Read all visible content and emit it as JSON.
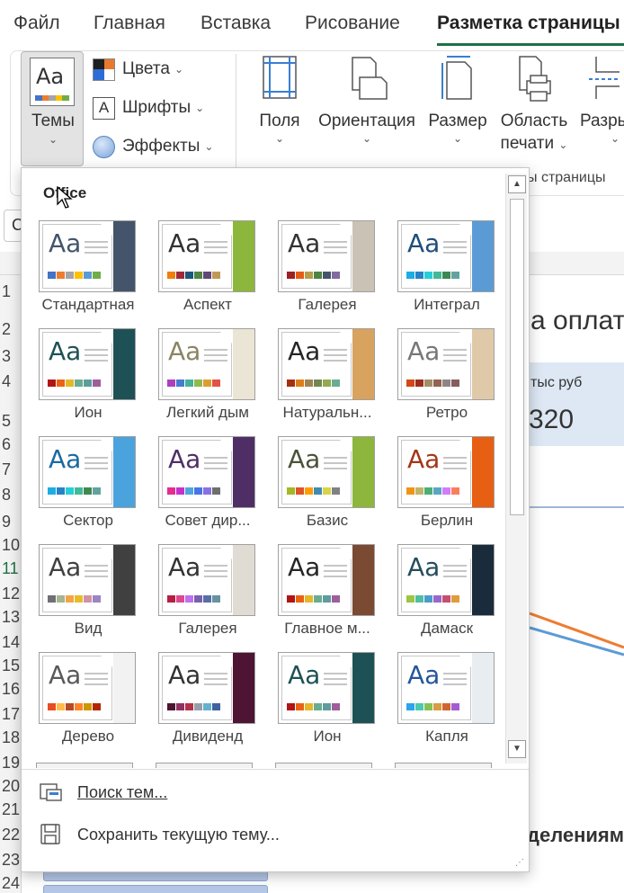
{
  "tabs": [
    "Файл",
    "Главная",
    "Вставка",
    "Рисование",
    "Разметка страницы"
  ],
  "ribbon": {
    "themes_label": "Темы",
    "colors_label": "Цвета",
    "fonts_label": "Шрифты",
    "effects_label": "Эффекты",
    "margins_label": "Поля",
    "orientation_label": "Ориентация",
    "size_label": "Размер",
    "print_area_line1": "Область",
    "print_area_line2": "печати",
    "breaks_label": "Разры",
    "group_label": "ы страницы",
    "icons": [
      "themes-icon",
      "colors-icon",
      "fonts-icon",
      "effects-icon",
      "margins-icon",
      "orientation-icon",
      "size-icon",
      "print-area-icon",
      "breaks-icon"
    ]
  },
  "sheet": {
    "namebox_text": "С",
    "rows": [
      "1",
      "2",
      "3",
      "4",
      "5",
      "6",
      "7",
      "8",
      "9",
      "10",
      "11",
      "12",
      "13",
      "14",
      "15",
      "16",
      "17",
      "18",
      "19",
      "20",
      "21",
      "22",
      "23",
      "24"
    ],
    "title_fragment": "а оплат",
    "unit_fragment": "тыс руб",
    "value_fragment": "320",
    "bottom_fragment": "делениям"
  },
  "dropdown": {
    "section_title": "Office",
    "themes": [
      {
        "name": "Стандартная",
        "font_color": "#44546a",
        "accent": "#44546a",
        "swatches": [
          "#4472c4",
          "#ed7d31",
          "#a5a5a5",
          "#ffc000",
          "#5b9bd5",
          "#70ad47"
        ]
      },
      {
        "name": "Аспект",
        "font_color": "#323232",
        "accent": "#8db63c",
        "swatches": [
          "#f07f09",
          "#9f2936",
          "#1b587c",
          "#4e8542",
          "#604878",
          "#c19859"
        ]
      },
      {
        "name": "Галерея",
        "font_color": "#333333",
        "accent": "#c9c2b5",
        "swatches": [
          "#9c2222",
          "#e55c18",
          "#b79c4a",
          "#4e8542",
          "#44546a",
          "#826b9e"
        ]
      },
      {
        "name": "Интеграл",
        "font_color": "#1f4e79",
        "accent": "#5b9bd5",
        "swatches": [
          "#1cade4",
          "#2683c6",
          "#27ced7",
          "#42ba97",
          "#3e8853",
          "#62a39f"
        ]
      },
      {
        "name": "Ион",
        "font_color": "#1e5155",
        "accent": "#1e5155",
        "swatches": [
          "#b01513",
          "#ea6312",
          "#e6b729",
          "#6aac90",
          "#5f9c9d",
          "#9e5e9b"
        ]
      },
      {
        "name": "Легкий дым",
        "font_color": "#8a8564",
        "accent": "#eae5d4",
        "swatches": [
          "#ac3ec1",
          "#477bd1",
          "#46b298",
          "#90ba4c",
          "#dd9d31",
          "#e25345"
        ]
      },
      {
        "name": "Натуральн...",
        "font_color": "#262626",
        "accent": "#d7a35f",
        "swatches": [
          "#a53010",
          "#de7e18",
          "#9f8351",
          "#728653",
          "#92aa4c",
          "#6aac91"
        ]
      },
      {
        "name": "Ретро",
        "font_color": "#777777",
        "accent": "#e0c9a8",
        "swatches": [
          "#d34817",
          "#9b2d1f",
          "#a28e6a",
          "#956251",
          "#918485",
          "#855d5d"
        ]
      },
      {
        "name": "Сектор",
        "font_color": "#1a6aa1",
        "accent": "#4ba3dd",
        "swatches": [
          "#1cade4",
          "#2683c6",
          "#27ced7",
          "#42ba97",
          "#3e8853",
          "#62a39f"
        ]
      },
      {
        "name": "Совет дир...",
        "font_color": "#4f2e66",
        "accent": "#4f2e66",
        "swatches": [
          "#e32d91",
          "#c830cc",
          "#4ea6dc",
          "#4775e7",
          "#8971e1",
          "#6e6e6e"
        ]
      },
      {
        "name": "Базис",
        "font_color": "#4a5238",
        "accent": "#8db63c",
        "swatches": [
          "#a6b727",
          "#df5327",
          "#fe9e00",
          "#418ab3",
          "#d7d447",
          "#818183"
        ]
      },
      {
        "name": "Берлин",
        "font_color": "#a33619",
        "accent": "#e65f13",
        "swatches": [
          "#f09415",
          "#c1b56b",
          "#4baf73",
          "#5aa6c0",
          "#d17df9",
          "#fa7e5c"
        ]
      },
      {
        "name": "Вид",
        "font_color": "#404040",
        "accent": "#404040",
        "swatches": [
          "#6f6f74",
          "#a5b592",
          "#f3a447",
          "#e7bc29",
          "#d092a7",
          "#9c85c0"
        ]
      },
      {
        "name": "Галерея",
        "font_color": "#333333",
        "accent": "#e0dcd4",
        "swatches": [
          "#b71e42",
          "#de478e",
          "#bc72f0",
          "#795faf",
          "#586ea6",
          "#6892a0"
        ]
      },
      {
        "name": "Главное м...",
        "font_color": "#262626",
        "accent": "#7a4a32",
        "swatches": [
          "#b01513",
          "#ea6312",
          "#e6b729",
          "#6aac90",
          "#5f9c9d",
          "#9e5e9b"
        ]
      },
      {
        "name": "Дамаск",
        "font_color": "#264d5e",
        "accent": "#1a2b3c",
        "swatches": [
          "#9ec544",
          "#50bea3",
          "#4a9ccc",
          "#9a66ca",
          "#c54f71",
          "#de9c3c"
        ]
      },
      {
        "name": "Дерево",
        "font_color": "#595959",
        "accent": "#f2f2f2",
        "swatches": [
          "#e84c22",
          "#ffbd47",
          "#b64926",
          "#ff8427",
          "#cc9900",
          "#b22600"
        ]
      },
      {
        "name": "Дивиденд",
        "font_color": "#333333",
        "accent": "#4d1434",
        "swatches": [
          "#4d1434",
          "#903163",
          "#b2324b",
          "#969fa7",
          "#66b1ce",
          "#40619d"
        ]
      },
      {
        "name": "Ион",
        "font_color": "#1e5155",
        "accent": "#1e5155",
        "swatches": [
          "#b01513",
          "#ea6312",
          "#e6b729",
          "#6aac90",
          "#5f9c9d",
          "#9e5e9b"
        ]
      },
      {
        "name": "Капля",
        "font_color": "#24569b",
        "accent": "#e8edf2",
        "swatches": [
          "#2fa3ee",
          "#4bcaad",
          "#86c157",
          "#d99c3f",
          "#ce6633",
          "#a35dd1"
        ]
      }
    ],
    "search_label": "Поиск тем...",
    "save_label": "Сохранить текущую тему...",
    "scroll_up": "▲",
    "scroll_down": "▼"
  },
  "colors": {
    "excel_green": "#1e7145",
    "sheet_blue_fill": "#dde8f4",
    "chart_orange": "#ed7d31",
    "chart_blue": "#5b9bd5"
  }
}
